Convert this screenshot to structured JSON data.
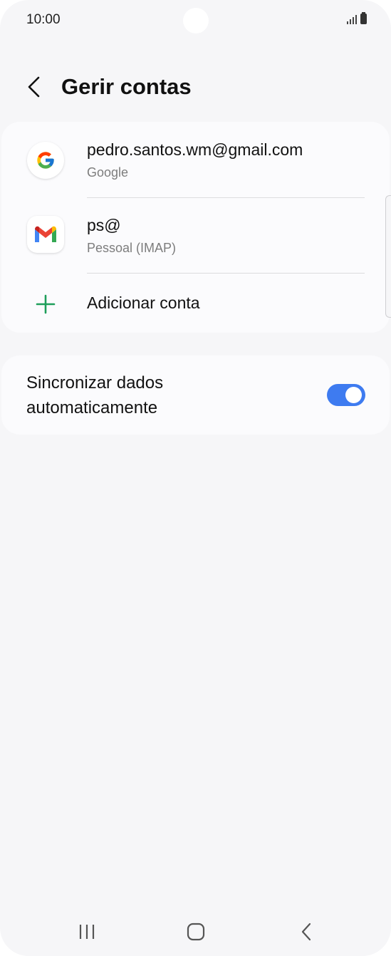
{
  "status_bar": {
    "time": "10:00",
    "icons": [
      "signal-icon",
      "battery-icon"
    ]
  },
  "header": {
    "title": "Gerir contas",
    "back_icon": "chevron-left-icon"
  },
  "accounts": [
    {
      "title": "pedro.santos.wm@gmail.com",
      "subtitle": "Google",
      "icon": "google-icon"
    },
    {
      "title": "ps@",
      "subtitle": "Pessoal (IMAP)",
      "icon": "gmail-icon"
    }
  ],
  "add_account": {
    "label": "Adicionar conta",
    "icon": "plus-icon",
    "color": "#1e9e5a"
  },
  "sync": {
    "label": "Sincronizar dados automaticamente",
    "enabled": true,
    "toggle_color": "#3e7bf0"
  },
  "nav_bar": {
    "icons": [
      "recent-apps-icon",
      "home-icon",
      "back-icon"
    ]
  }
}
